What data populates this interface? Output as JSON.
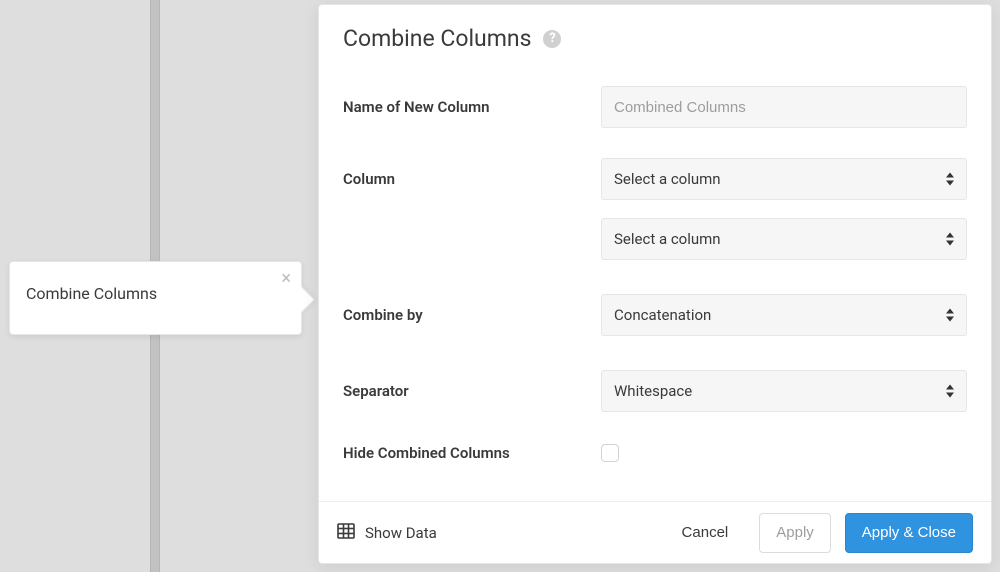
{
  "node": {
    "title": "Combine Columns",
    "close_icon_label": "close"
  },
  "panel": {
    "title": "Combine Columns",
    "help_icon_label": "help",
    "form": {
      "name_label": "Name of New Column",
      "name_placeholder": "Combined Columns",
      "name_value": "",
      "column_label": "Column",
      "column_select_1": "Select a column",
      "column_select_2": "Select a column",
      "combine_by_label": "Combine by",
      "combine_by_value": "Concatenation",
      "separator_label": "Separator",
      "separator_value": "Whitespace",
      "hide_label": "Hide Combined Columns",
      "hide_checked": false
    },
    "footer": {
      "show_data_label": "Show Data",
      "cancel_label": "Cancel",
      "apply_label": "Apply",
      "apply_close_label": "Apply & Close"
    }
  }
}
